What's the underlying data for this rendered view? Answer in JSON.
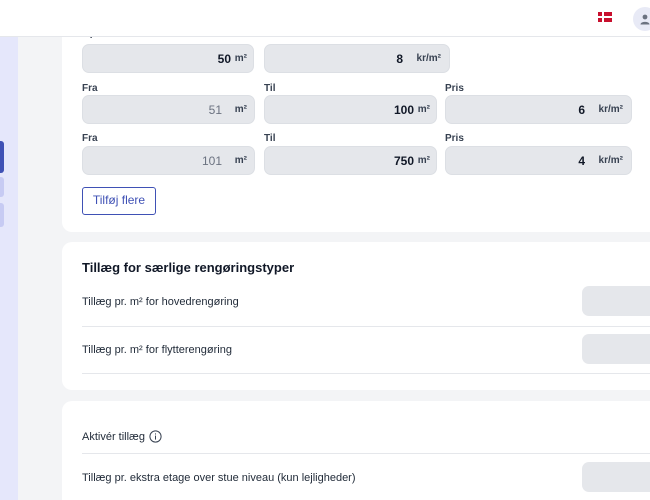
{
  "header": {
    "language_flag": "denmark-flag",
    "user_icon": "user-icon"
  },
  "price_table": {
    "top_row": {
      "label_from": "Op til",
      "label_price": "Pris",
      "to_value": "50",
      "area_unit": "m²",
      "price_value": "8",
      "price_unit": "kr/m²"
    },
    "rows": [
      {
        "label_from": "Fra",
        "label_to": "Til",
        "label_price": "Pris",
        "from_value": "51",
        "from_unit": "m²",
        "to_value": "100",
        "to_unit": "m²",
        "price_value": "6",
        "price_unit": "kr/m²"
      },
      {
        "label_from": "Fra",
        "label_to": "Til",
        "label_price": "Pris",
        "from_value": "101",
        "from_unit": "m²",
        "to_value": "750",
        "to_unit": "m²",
        "price_value": "4",
        "price_unit": "kr/m²"
      }
    ],
    "add_more_label": "Tilføj flere"
  },
  "special_cleaning": {
    "title": "Tillæg for særlige rengøringstyper",
    "items": [
      {
        "label": "Tillæg pr. m² for hovedrengøring"
      },
      {
        "label": "Tillæg pr. m² for flytterengøring"
      }
    ]
  },
  "surcharge": {
    "activate_label": "Aktivér tillæg",
    "items": [
      {
        "label": "Tillæg pr. ekstra etage over stue niveau (kun lejligheder)"
      }
    ]
  }
}
